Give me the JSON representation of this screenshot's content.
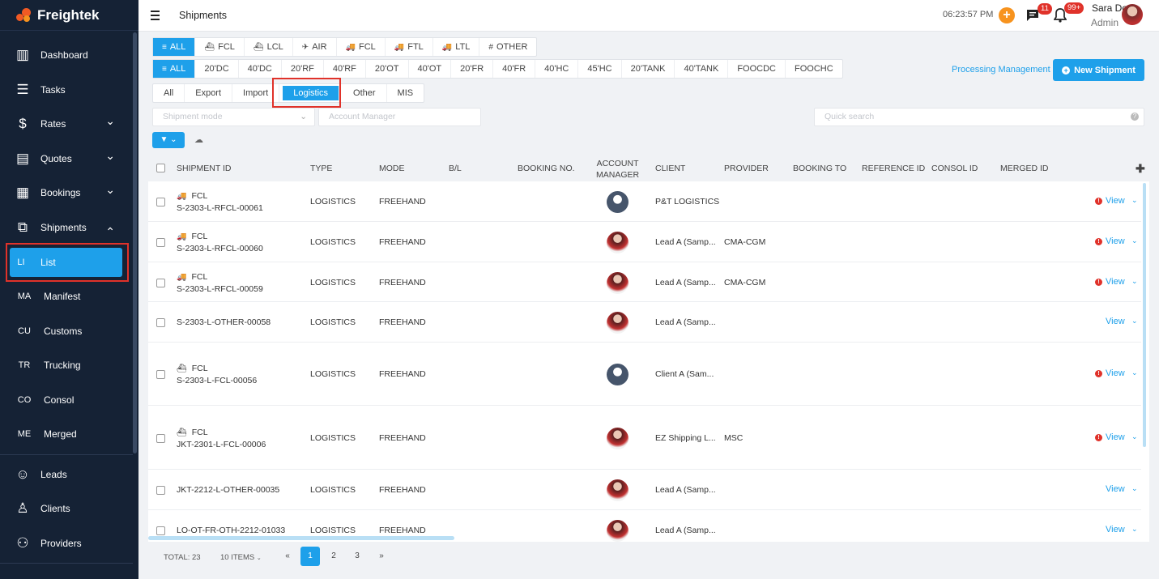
{
  "app": {
    "name": "Freightek",
    "brand_color": "#1ea0ea",
    "sidebar_bg": "#152235"
  },
  "sidebar": {
    "items": [
      {
        "label": "Dashboard",
        "icon": "dashboard-icon"
      },
      {
        "label": "Tasks",
        "icon": "tasks-icon"
      },
      {
        "label": "Rates",
        "icon": "rates-icon"
      },
      {
        "label": "Quotes",
        "icon": "quotes-icon"
      },
      {
        "label": "Bookings",
        "icon": "bookings-icon"
      },
      {
        "label": "Shipments",
        "icon": "shipments-icon"
      }
    ],
    "sub_items": [
      {
        "abbr": "LI",
        "label": "List"
      },
      {
        "abbr": "MA",
        "label": "Manifest"
      },
      {
        "abbr": "CU",
        "label": "Customs"
      },
      {
        "abbr": "TR",
        "label": "Trucking"
      },
      {
        "abbr": "CO",
        "label": "Consol"
      },
      {
        "abbr": "ME",
        "label": "Merged"
      }
    ],
    "bottom_items": [
      {
        "label": "Leads",
        "icon": "leads-icon"
      },
      {
        "label": "Clients",
        "icon": "clients-icon"
      },
      {
        "label": "Providers",
        "icon": "providers-icon"
      }
    ]
  },
  "header": {
    "title": "Shipments",
    "clock": "06:23:57 PM",
    "plus": "+",
    "messages_badge": "11",
    "notifications_badge": "99+",
    "user_name": "Sara Do",
    "user_role": "Admin"
  },
  "mode_tabs": [
    {
      "label": "ALL",
      "icon": "≡"
    },
    {
      "label": "FCL",
      "icon": "⛴"
    },
    {
      "label": "LCL",
      "icon": "⛴"
    },
    {
      "label": "AIR",
      "icon": "✈"
    },
    {
      "label": "FCL",
      "icon": "🚚"
    },
    {
      "label": "FTL",
      "icon": "🚚"
    },
    {
      "label": "LTL",
      "icon": "🚚"
    },
    {
      "label": "OTHER",
      "icon": "#"
    }
  ],
  "container_tabs": [
    {
      "label": "ALL",
      "icon": "≡"
    },
    {
      "label": "20'DC",
      "icon": ""
    },
    {
      "label": "40'DC",
      "icon": ""
    },
    {
      "label": "20'RF",
      "icon": ""
    },
    {
      "label": "40'RF",
      "icon": ""
    },
    {
      "label": "20'OT",
      "icon": ""
    },
    {
      "label": "40'OT",
      "icon": ""
    },
    {
      "label": "20'FR",
      "icon": ""
    },
    {
      "label": "40'FR",
      "icon": ""
    },
    {
      "label": "40'HC",
      "icon": ""
    },
    {
      "label": "45'HC",
      "icon": ""
    },
    {
      "label": "20'TANK",
      "icon": ""
    },
    {
      "label": "40'TANK",
      "icon": ""
    },
    {
      "label": "FOOCDC",
      "icon": ""
    },
    {
      "label": "FOOCHC",
      "icon": ""
    }
  ],
  "type_tabs": [
    "All",
    "Export",
    "Import",
    "Logistics",
    "Other",
    "MIS"
  ],
  "actions": {
    "processing": "Processing Management",
    "new_shipment": "New Shipment"
  },
  "filters": {
    "shipment_mode": "Shipment mode",
    "account_manager": "Account Manager",
    "quick_search": "Quick search"
  },
  "table": {
    "columns": [
      "SHIPMENT ID",
      "TYPE",
      "MODE",
      "B/L",
      "BOOKING NO.",
      "ACCOUNT MANAGER",
      "CLIENT",
      "PROVIDER",
      "BOOKING TO",
      "REFERENCE ID",
      "CONSOL ID",
      "MERGED ID"
    ],
    "account_manager_line1": "ACCOUNT",
    "account_manager_line2": "MANAGER",
    "view_label": "View",
    "rows": [
      {
        "mode_tag": "FCL",
        "tag_icon": "truck-icon",
        "id": "S-2303-L-RFCL-00061",
        "type": "LOGISTICS",
        "mode": "FREEHAND",
        "avatar": "gray",
        "client": "P&T LOGISTICS",
        "provider": "",
        "warning": true
      },
      {
        "mode_tag": "FCL",
        "tag_icon": "truck-icon",
        "id": "S-2303-L-RFCL-00060",
        "type": "LOGISTICS",
        "mode": "FREEHAND",
        "avatar": "photo",
        "client": "Lead A (Samp...",
        "provider": "CMA-CGM",
        "warning": true
      },
      {
        "mode_tag": "FCL",
        "tag_icon": "truck-icon",
        "id": "S-2303-L-RFCL-00059",
        "type": "LOGISTICS",
        "mode": "FREEHAND",
        "avatar": "photo",
        "client": "Lead A (Samp...",
        "provider": "CMA-CGM",
        "warning": true
      },
      {
        "mode_tag": "",
        "tag_icon": "",
        "id": "S-2303-L-OTHER-00058",
        "type": "LOGISTICS",
        "mode": "FREEHAND",
        "avatar": "photo",
        "client": "Lead A (Samp...",
        "provider": "",
        "warning": false
      },
      {
        "mode_tag": "FCL",
        "tag_icon": "ship-icon",
        "id": "S-2303-L-FCL-00056",
        "type": "LOGISTICS",
        "mode": "FREEHAND",
        "avatar": "gray",
        "client": "Client A (Sam...",
        "provider": "",
        "warning": true
      },
      {
        "mode_tag": "FCL",
        "tag_icon": "ship-icon",
        "id": "JKT-2301-L-FCL-00006",
        "type": "LOGISTICS",
        "mode": "FREEHAND",
        "avatar": "photo",
        "client": "EZ Shipping L...",
        "provider": "MSC",
        "warning": true
      },
      {
        "mode_tag": "",
        "tag_icon": "",
        "id": "JKT-2212-L-OTHER-00035",
        "type": "LOGISTICS",
        "mode": "FREEHAND",
        "avatar": "photo",
        "client": "Lead A (Samp...",
        "provider": "",
        "warning": false
      },
      {
        "mode_tag": "",
        "tag_icon": "",
        "id": "LO-OT-FR-OTH-2212-01033",
        "type": "LOGISTICS",
        "mode": "FREEHAND",
        "avatar": "photo",
        "client": "Lead A (Samp...",
        "provider": "",
        "warning": false
      }
    ]
  },
  "pagination": {
    "total": "TOTAL: 23",
    "per_page": "10 ITEMS",
    "prev": "«",
    "pages": [
      "1",
      "2",
      "3"
    ],
    "next": "»"
  }
}
